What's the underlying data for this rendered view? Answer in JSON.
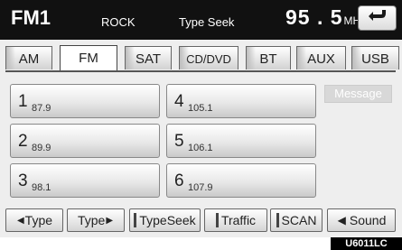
{
  "header": {
    "band": "FM1",
    "genre": "ROCK",
    "seek_mode": "Type Seek",
    "frequency": "95 . 5",
    "frequency_unit": "MHz",
    "back_icon": "return-arrow-icon"
  },
  "tabs": [
    {
      "label": "AM",
      "active": false
    },
    {
      "label": "FM",
      "active": true
    },
    {
      "label": "SAT",
      "active": false
    },
    {
      "label": "CD/DVD",
      "active": false
    },
    {
      "label": "BT",
      "active": false
    },
    {
      "label": "AUX",
      "active": false
    },
    {
      "label": "USB",
      "active": false
    }
  ],
  "presets": [
    {
      "number": "1",
      "freq": "87.9"
    },
    {
      "number": "2",
      "freq": "89.9"
    },
    {
      "number": "3",
      "freq": "98.1"
    },
    {
      "number": "4",
      "freq": "105.1"
    },
    {
      "number": "5",
      "freq": "106.1"
    },
    {
      "number": "6",
      "freq": "107.9"
    }
  ],
  "message_label": "Message",
  "bottom": {
    "type_prev": "Type",
    "type_next": "Type",
    "type_seek": "TypeSeek",
    "traffic": "Traffic",
    "scan": "SCAN",
    "sound": "Sound"
  },
  "figure_code": "U6011LC",
  "colors": {
    "header_bg": "#111111",
    "screen_bg": "#eeeeee",
    "disabled_text": "#ffffff"
  }
}
